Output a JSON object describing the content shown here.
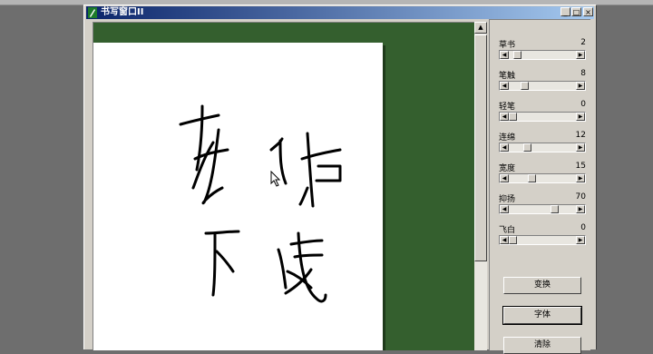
{
  "window": {
    "title": "书写窗口II",
    "minimize_glyph": "_",
    "maximize_glyph": "□",
    "close_glyph": "×"
  },
  "scrollbar": {
    "up_glyph": "▲",
    "down_glyph": "▼"
  },
  "params": [
    {
      "label": "草书",
      "value": "2",
      "level": 0.08
    },
    {
      "label": "笔触",
      "value": "8",
      "level": 0.2
    },
    {
      "label": "轻笔",
      "value": "0",
      "level": 0.0
    },
    {
      "label": "连绵",
      "value": "12",
      "level": 0.25
    },
    {
      "label": "宽度",
      "value": "15",
      "level": 0.33
    },
    {
      "label": "抑扬",
      "value": "70",
      "level": 0.7
    },
    {
      "label": "飞白",
      "value": "0",
      "level": 0.0
    }
  ],
  "slider_arrows": {
    "left": "◀",
    "right": "▶"
  },
  "buttons": {
    "convert": "变换",
    "font": "字体",
    "clear": "清除"
  },
  "icons": {
    "app": "brush-icon",
    "cursor": "mouse-cursor-icon"
  }
}
